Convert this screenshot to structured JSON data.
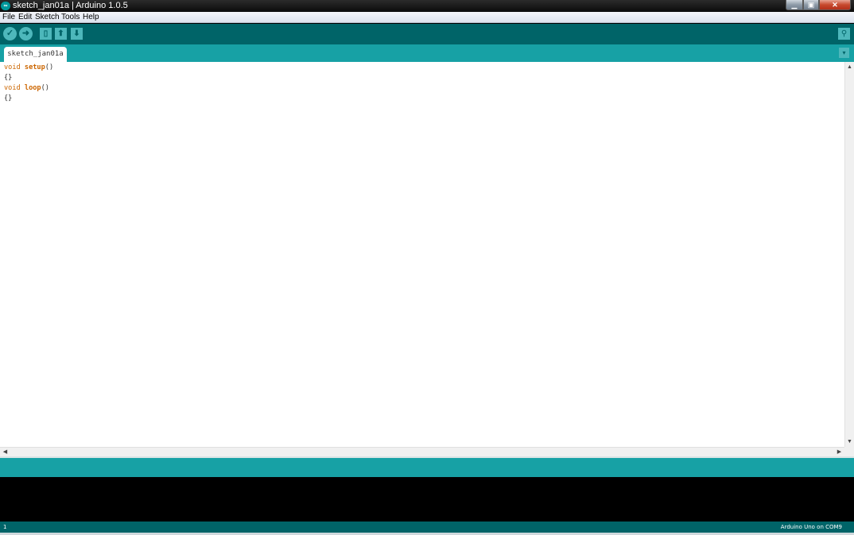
{
  "window": {
    "title": "sketch_jan01a | Arduino 1.0.5",
    "app_icon": "arduino-infinity-icon",
    "icon_glyph": "∞",
    "minimize_glyph": "▁",
    "maximize_glyph": "▣",
    "close_glyph": "✕"
  },
  "menu": {
    "items": [
      "File",
      "Edit",
      "Sketch",
      "Tools",
      "Help"
    ]
  },
  "toolbar": {
    "verify_glyph": "✓",
    "upload_glyph": "➜",
    "new_glyph": "▯",
    "open_glyph": "⬆",
    "save_glyph": "⬇",
    "serial_monitor_glyph": "⚲"
  },
  "tabs": {
    "active_label": "sketch_jan01a",
    "menu_glyph": "▾"
  },
  "editor": {
    "line1_type": "void",
    "line1_func": "setup",
    "line1_parens": "()",
    "line2": "{}",
    "line3_type": "void",
    "line3_func": "loop",
    "line3_parens": "()",
    "line4": "{}"
  },
  "scrollbars": {
    "up_glyph": "▲",
    "down_glyph": "▼",
    "left_glyph": "◀",
    "right_glyph": "▶"
  },
  "status": {
    "line_number": "1",
    "board": "Arduino Uno on COM9"
  },
  "colors": {
    "toolbar": "#006468",
    "tabstrip": "#17a1a5",
    "keyword": "#cc6600",
    "console": "#000000"
  }
}
